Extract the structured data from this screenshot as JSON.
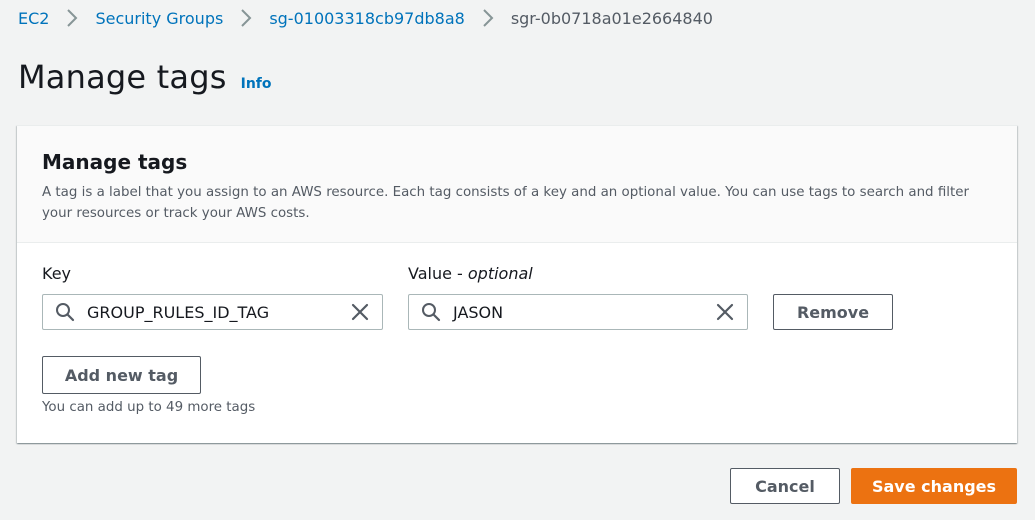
{
  "breadcrumb": {
    "items": [
      "EC2",
      "Security Groups",
      "sg-01003318cb97db8a8"
    ],
    "current": "sgr-0b0718a01e2664840"
  },
  "header": {
    "title": "Manage tags",
    "info": "Info"
  },
  "panel": {
    "title": "Manage tags",
    "description": "A tag is a label that you assign to an AWS resource. Each tag consists of a key and an optional value. You can use tags to search and filter your resources or track your AWS costs.",
    "key_label": "Key",
    "value_label": "Value - ",
    "value_label_optional": "optional",
    "tags": [
      {
        "key": "GROUP_RULES_ID_TAG",
        "value": "JASON",
        "remove_label": "Remove"
      }
    ],
    "add_button": "Add new tag",
    "hint": "You can add up to 49 more tags"
  },
  "footer": {
    "cancel": "Cancel",
    "save": "Save changes"
  },
  "colors": {
    "link": "#0073bb",
    "primary": "#ec7211",
    "background": "#f2f3f3"
  }
}
